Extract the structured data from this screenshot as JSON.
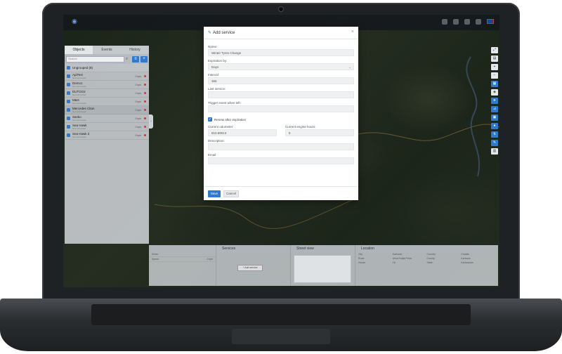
{
  "modal": {
    "title": "Add service",
    "title_icon": "wrench-icon",
    "close": "×",
    "fields": {
      "name_label": "Name:",
      "name_value": "Winter Tyres Change",
      "expiration_label": "Expiration by:",
      "expiration_value": "Days",
      "interval_label": "Interval:",
      "interval_value": "365",
      "last_service_label": "Last service:",
      "last_service_value": "",
      "trigger_label": "Trigger event when left:",
      "trigger_value": "",
      "renew_label": "Renew after expiration",
      "renew_checked": true,
      "odometer_label": "Current odometer:",
      "odometer_value": "810.69013",
      "engine_hours_label": "Current engine hours:",
      "engine_hours_value": "5",
      "description_label": "Description:",
      "description_value": "",
      "email_label": "Email:",
      "email_value": ""
    },
    "save_label": "Save",
    "cancel_label": "Cancel"
  },
  "leftpanel": {
    "tabs": [
      "Objects",
      "Events",
      "History"
    ],
    "search_placeholder": "Search",
    "group": {
      "name": "Ungrouped (8)"
    },
    "objects": [
      {
        "name": "ApiTest",
        "sub": "Not connected",
        "speed": "0 kph"
      },
      {
        "name": "Demo1",
        "sub": "Not connected",
        "speed": "0 kph"
      },
      {
        "name": "DUTOO2",
        "sub": "Not connected",
        "speed": "0 kph"
      },
      {
        "name": "M&S",
        "sub": "Not connected",
        "speed": "0 kph"
      },
      {
        "name": "Mercedes Citan",
        "sub": "Not connected",
        "speed": "0 kph"
      },
      {
        "name": "Sanko",
        "sub": "Not connected",
        "speed": "0 kph"
      },
      {
        "name": "Sea Hawk",
        "sub": "Not connected",
        "speed": "0 kph"
      },
      {
        "name": "Sea Hawk 2",
        "sub": "Not connected",
        "speed": "0 kph"
      }
    ]
  },
  "bottom": {
    "details": [
      {
        "k": "Driver",
        "v": ""
      },
      {
        "k": "Speed",
        "v": "0 kph"
      }
    ],
    "services_title": "Services",
    "add_service_label": "+ Add service",
    "street_title": "Street view",
    "location_title": "Location",
    "location": [
      {
        "k1": "City",
        "v1": "Karlovac",
        "k2": "Country",
        "v2": "Croatia"
      },
      {
        "k1": "Road",
        "v1": "Ulica Kralja Petra",
        "k2": "County",
        "v2": "Karlovac"
      },
      {
        "k1": "House",
        "v1": "16",
        "k2": "State",
        "v2": "Karlovacka"
      }
    ]
  },
  "colors": {
    "accent": "#2e7ad1",
    "offline_dot": "#dd3333"
  }
}
